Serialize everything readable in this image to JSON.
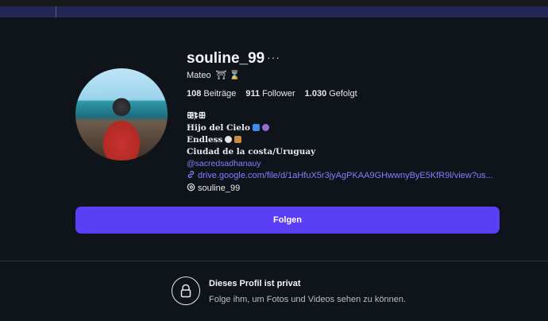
{
  "profile": {
    "username": "souline_99",
    "more_label": "···",
    "full_name": "Mateo",
    "stats": {
      "posts_count": "108",
      "posts_label": "Beiträge",
      "followers_count": "911",
      "followers_label": "Follower",
      "following_count": "1.030",
      "following_label": "Gefolgt"
    },
    "bio": {
      "line1": "ꕥ҉ꔪꕥ",
      "line2": "Hijo del Cielo",
      "line3": "Endless",
      "line4": "Ciudad de la costa/Uruguay",
      "mention": "@sacredsadhanauy"
    },
    "link": "drive.google.com/file/d/1aHfuX5r3jyAgPKAA9GHwwnyByE5KfR9l/view?us...",
    "threads_handle": "souline_99"
  },
  "actions": {
    "follow_label": "Folgen"
  },
  "private": {
    "title": "Dieses Profil ist privat",
    "subtitle": "Folge ihm, um Fotos und Videos sehen zu können."
  },
  "colors": {
    "background": "#0f141a",
    "accent": "#5b3ff6",
    "link": "#8b7bff"
  }
}
